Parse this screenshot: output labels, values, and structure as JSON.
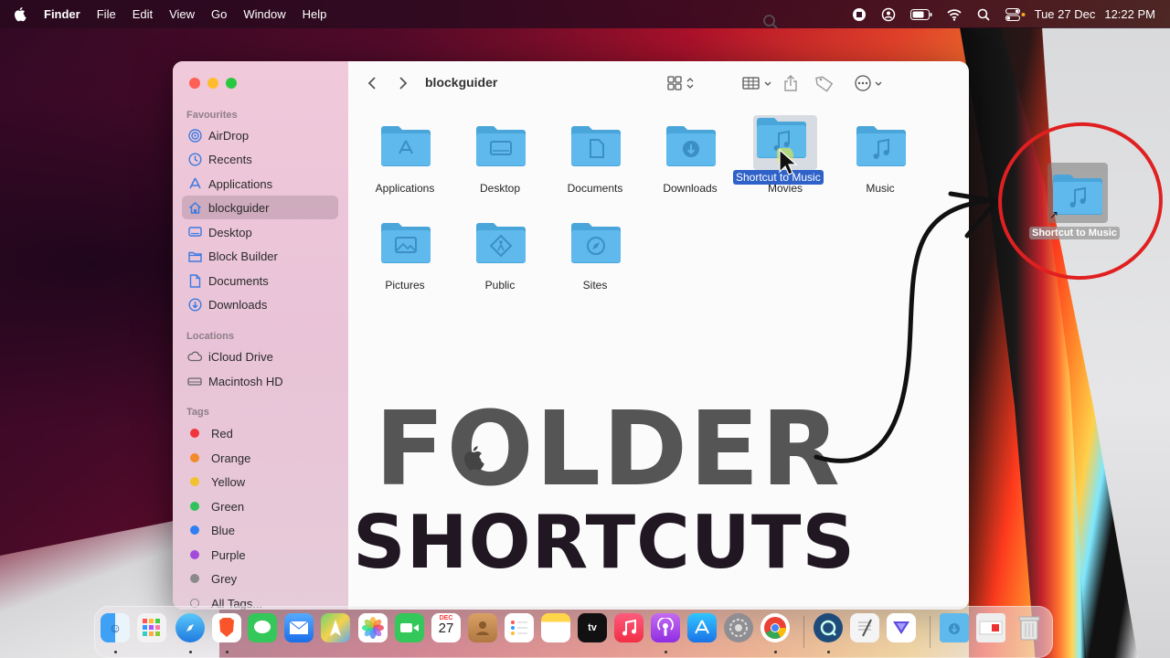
{
  "menubar": {
    "app": "Finder",
    "items": [
      "File",
      "Edit",
      "View",
      "Go",
      "Window",
      "Help"
    ],
    "date": "Tue 27 Dec",
    "time": "12:22 PM"
  },
  "finder": {
    "title": "blockguider",
    "sidebar": {
      "favourites_header": "Favourites",
      "favourites": [
        {
          "label": "AirDrop",
          "icon": "airdrop-icon"
        },
        {
          "label": "Recents",
          "icon": "clock-icon"
        },
        {
          "label": "Applications",
          "icon": "applications-icon"
        },
        {
          "label": "blockguider",
          "icon": "home-icon"
        },
        {
          "label": "Desktop",
          "icon": "desktop-icon"
        },
        {
          "label": "Block Builder",
          "icon": "folder-icon"
        },
        {
          "label": "Documents",
          "icon": "document-icon"
        },
        {
          "label": "Downloads",
          "icon": "download-icon"
        }
      ],
      "locations_header": "Locations",
      "locations": [
        {
          "label": "iCloud Drive",
          "icon": "cloud-icon"
        },
        {
          "label": "Macintosh HD",
          "icon": "disk-icon"
        }
      ],
      "tags_header": "Tags",
      "tags": [
        {
          "label": "Red",
          "color": "#f0353d"
        },
        {
          "label": "Orange",
          "color": "#f28b2c"
        },
        {
          "label": "Yellow",
          "color": "#f2c12e"
        },
        {
          "label": "Green",
          "color": "#2fc25b"
        },
        {
          "label": "Blue",
          "color": "#2f7ff2"
        },
        {
          "label": "Purple",
          "color": "#a24bd9"
        },
        {
          "label": "Grey",
          "color": "#8a8a8a"
        }
      ],
      "all_tags": "All Tags..."
    },
    "folders": [
      {
        "label": "Applications",
        "glyph": "applications"
      },
      {
        "label": "Desktop",
        "glyph": "desktop"
      },
      {
        "label": "Documents",
        "glyph": "document"
      },
      {
        "label": "Downloads",
        "glyph": "download"
      },
      {
        "label": "Movies",
        "glyph": "music"
      },
      {
        "label": "Music",
        "glyph": "music"
      },
      {
        "label": "Pictures",
        "glyph": "picture"
      },
      {
        "label": "Public",
        "glyph": "public"
      },
      {
        "label": "Sites",
        "glyph": "compass"
      }
    ],
    "drag_label": "Shortcut to Music"
  },
  "overlay": {
    "line1": "FOLDER",
    "line2": "SHORTCUTS"
  },
  "desktop": {
    "shortcut_label": "Shortcut to Music"
  },
  "dock": {
    "calendar_month": "DEC",
    "calendar_day": "27",
    "tv_label": "tv"
  },
  "colors": {
    "folder": "#5fb9ec",
    "folder_dark": "#4aa5da",
    "accent": "#2f62c8",
    "annotation": "#e02020"
  }
}
